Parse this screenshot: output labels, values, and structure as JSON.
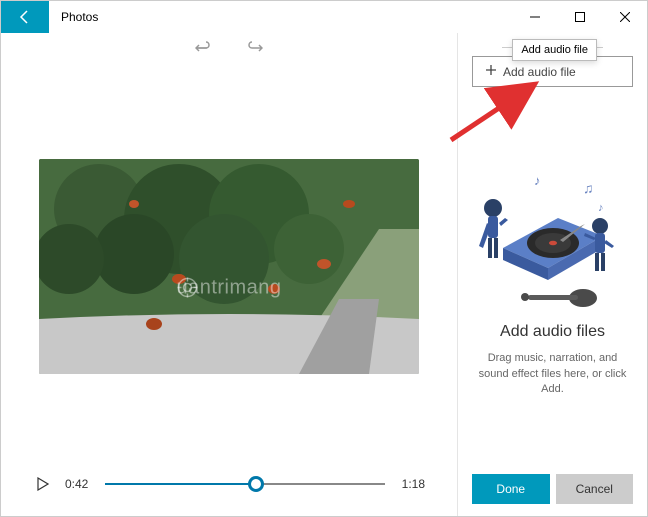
{
  "titlebar": {
    "app_name": "Photos"
  },
  "player": {
    "current_time": "0:42",
    "total_time": "1:18",
    "progress_pct": 54
  },
  "sidepanel": {
    "tooltip": "Add audio file",
    "add_button_label": "Add audio file",
    "heading": "Add audio files",
    "subtext": "Drag music, narration, and sound effect files here, or click Add."
  },
  "buttons": {
    "done": "Done",
    "cancel": "Cancel"
  },
  "watermark": "uantrimang"
}
